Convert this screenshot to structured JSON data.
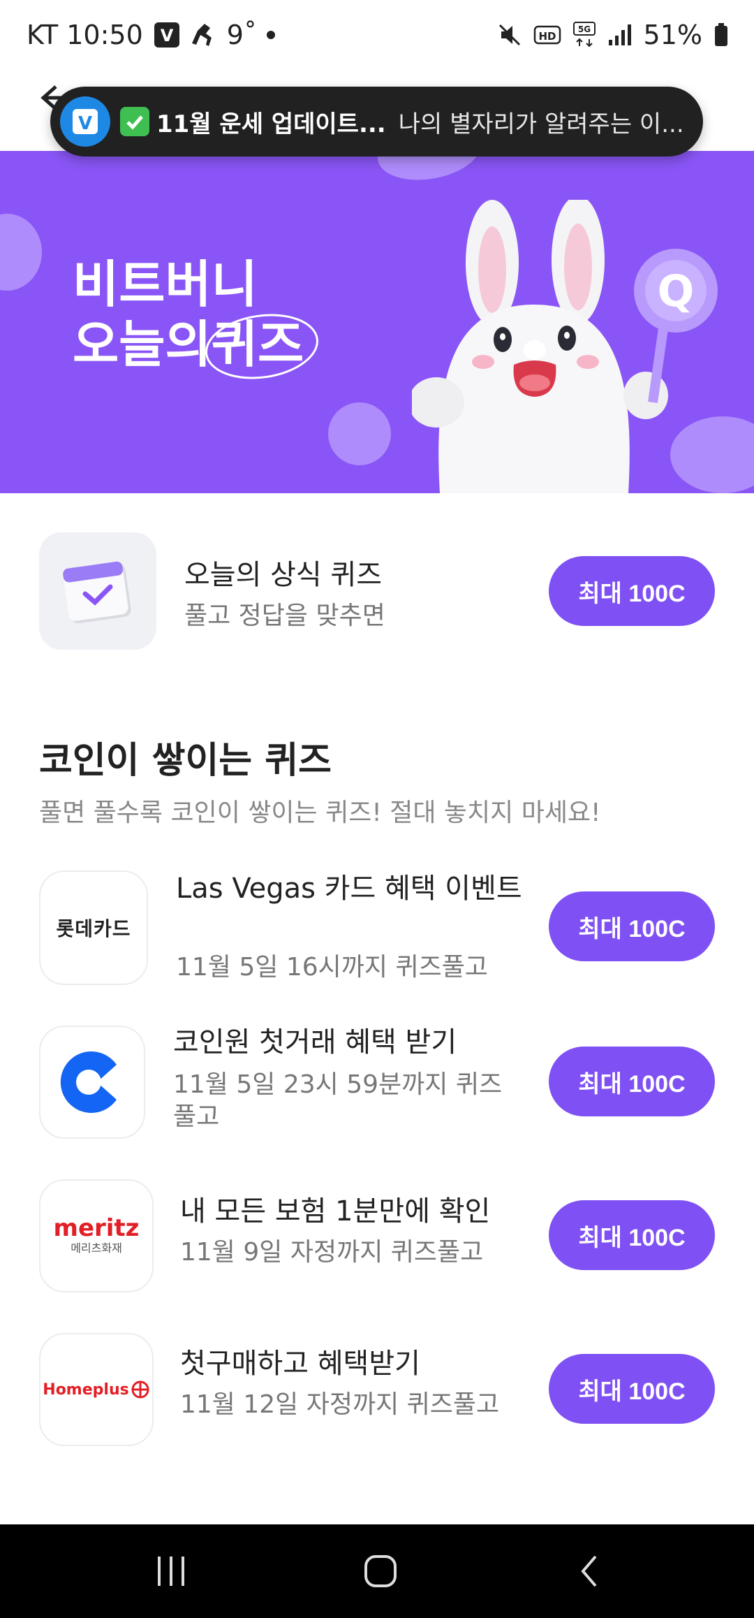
{
  "status_bar": {
    "carrier_time": "KT 10:50",
    "temperature": "9˚",
    "battery": "51%"
  },
  "toast": {
    "title": "11월 운세 업데이트...",
    "body": "나의 별자리가 알려주는 이..."
  },
  "banner": {
    "line1": "비트버니",
    "line2_prefix": "오늘의",
    "line2_circled": "퀴즈"
  },
  "daily_quiz": {
    "title": "오늘의 상식 퀴즈",
    "subtitle": "풀고 정답을 맞추면",
    "button": "최대 100C"
  },
  "section": {
    "title": "코인이 쌓이는 퀴즈",
    "subtitle": "풀면 풀수록 코인이 쌓이는 퀴즈! 절대 놓치지 마세요!"
  },
  "quizzes": [
    {
      "logo_text": "롯데카드",
      "title": "Las Vegas 카드 혜택 이벤트",
      "subtitle": "11월 5일 16시까지 퀴즈풀고",
      "button": "최대 100C"
    },
    {
      "logo_text": "",
      "title": "코인원 첫거래 혜택 받기",
      "subtitle": "11월 5일 23시 59분까지 퀴즈풀고",
      "button": "최대 100C"
    },
    {
      "logo_text": "meritz",
      "logo_subtext": "메리츠화재",
      "title": "내 모든 보험 1분만에 확인",
      "subtitle": "11월 9일 자정까지 퀴즈풀고",
      "button": "최대 100C"
    },
    {
      "logo_text": "Homeplus",
      "title": "첫구매하고 혜택받기",
      "subtitle": "11월 12일 자정까지 퀴즈풀고",
      "button": "최대 100C"
    }
  ],
  "colors": {
    "accent": "#7f50f3",
    "banner": "#8a55f6",
    "coinone_blue": "#1565f5",
    "meritz_red": "#e21f26"
  }
}
